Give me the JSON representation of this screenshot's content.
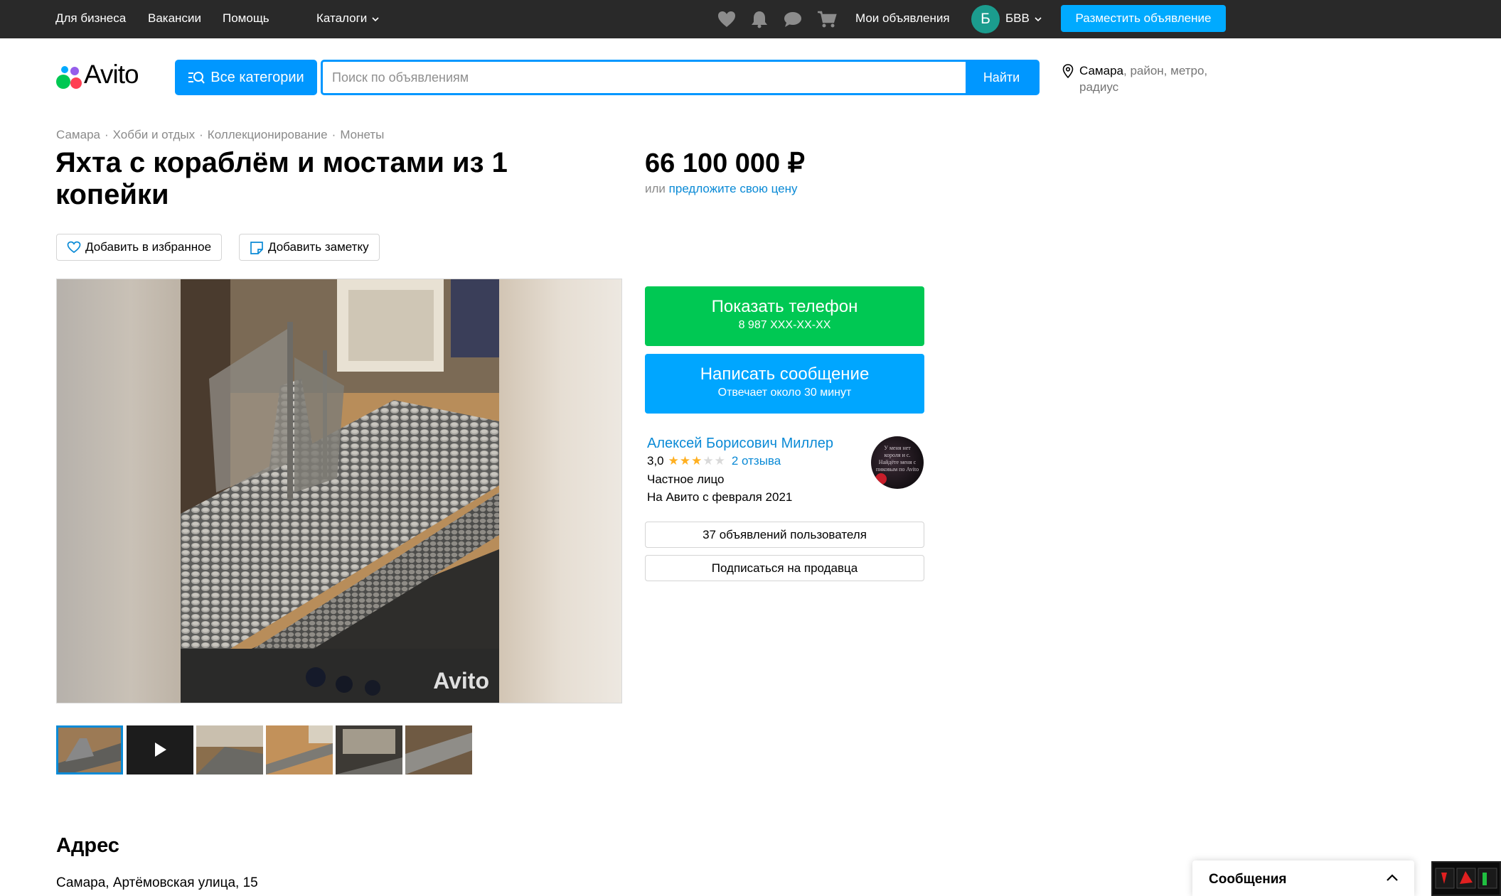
{
  "topbar": {
    "for_business": "Для бизнеса",
    "vacancies": "Вакансии",
    "help": "Помощь",
    "catalogs": "Каталоги",
    "my_ads": "Мои объявления",
    "avatar_letter": "Б",
    "user_name": "БВВ",
    "post_ad": "Разместить объявление",
    "icons": [
      "heart-icon",
      "bell-icon",
      "chat-icon",
      "cart-icon"
    ]
  },
  "header": {
    "logo_text": "Avito",
    "all_categories": "Все категории",
    "search_placeholder": "Поиск по объявлениям",
    "find": "Найти",
    "location": {
      "city": "Самара",
      "rest": "район, метро,",
      "radius": "радиус"
    }
  },
  "breadcrumbs": [
    "Самара",
    "Хобби и отдых",
    "Коллекционирование",
    "Монеты"
  ],
  "listing": {
    "title": "Яхта с кораблём и мостами из 1 копейки",
    "price": "66 100 000 ₽",
    "price_or": "или",
    "offer_price": "предложите свою цену",
    "add_favorite": "Добавить в избранное",
    "add_note": "Добавить заметку",
    "watermark": "Avito"
  },
  "contact": {
    "show_phone": "Показать телефон",
    "phone": "8 987 XXX-XX-XX",
    "write_message": "Написать сообщение",
    "response_time": "Отвечает около 30 минут"
  },
  "seller": {
    "name": "Алексей Борисович Миллер",
    "rating": "3,0",
    "stars": 3,
    "reviews": "2 отзыва",
    "type": "Частное лицо",
    "since": "На Авито с февраля 2021",
    "avatar_text": "У меня нет короля и с. Найдёте меня с пиковым по Avito",
    "user_ads": "37 объявлений пользователя",
    "subscribe": "Подписаться на продавца"
  },
  "address": {
    "heading": "Адрес",
    "text": "Самара, Артёмовская улица, 15"
  },
  "messages": {
    "label": "Сообщения"
  },
  "colors": {
    "topbar": "#292929",
    "accent_blue": "#0097ff",
    "green": "#00c853",
    "link": "#0a8ad6"
  }
}
